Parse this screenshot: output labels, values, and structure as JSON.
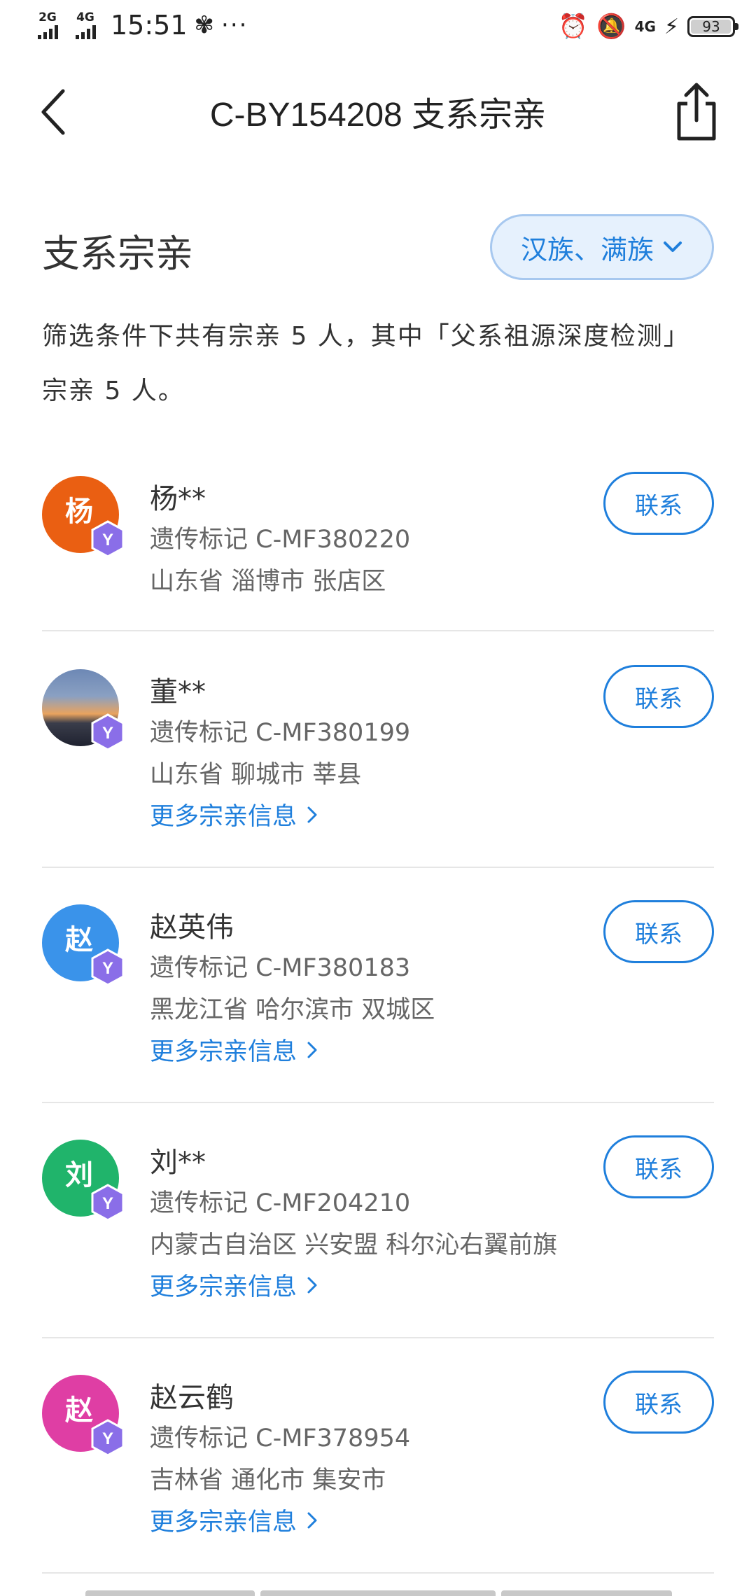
{
  "status_bar": {
    "network1": "2G",
    "network2": "4G",
    "time": "15:51",
    "fan_icon": "fan-icon",
    "more": "···",
    "net_4g": "4G",
    "battery": "93"
  },
  "header": {
    "title": "C-BY154208 支系宗亲",
    "back_icon": "back-arrow-icon",
    "share_icon": "share-icon"
  },
  "section": {
    "title": "支系宗亲",
    "filter_label": "汉族、满族"
  },
  "summary": "筛选条件下共有宗亲 5 人，其中「父系祖源深度检测」宗亲 5 人。",
  "contact_label": "联系",
  "more_label": "更多宗亲信息",
  "marker_prefix": "遗传标记",
  "people": [
    {
      "avatar_char": "杨",
      "avatar_color": "#ea5f12",
      "name": "杨**",
      "marker": "遗传标记 C-MF380220",
      "location": "山东省 淄博市 张店区",
      "has_more": false
    },
    {
      "avatar_char": "",
      "avatar_color": "photo",
      "name": "董**",
      "marker": "遗传标记 C-MF380199",
      "location": "山东省 聊城市 莘县",
      "has_more": true
    },
    {
      "avatar_char": "赵",
      "avatar_color": "#3a93ea",
      "name": "赵英伟",
      "marker": "遗传标记 C-MF380183",
      "location": "黑龙江省 哈尔滨市 双城区",
      "has_more": true
    },
    {
      "avatar_char": "刘",
      "avatar_color": "#20b46b",
      "name": "刘**",
      "marker": "遗传标记 C-MF204210",
      "location": "内蒙古自治区 兴安盟 科尔沁右翼前旗",
      "has_more": true
    },
    {
      "avatar_char": "赵",
      "avatar_color": "#df3ea4",
      "name": "赵云鹤",
      "marker": "遗传标记 C-MF378954",
      "location": "吉林省 通化市 集安市",
      "has_more": true
    }
  ],
  "colors": {
    "accent": "#1f7fdc",
    "badge": "#8a6ee8"
  }
}
